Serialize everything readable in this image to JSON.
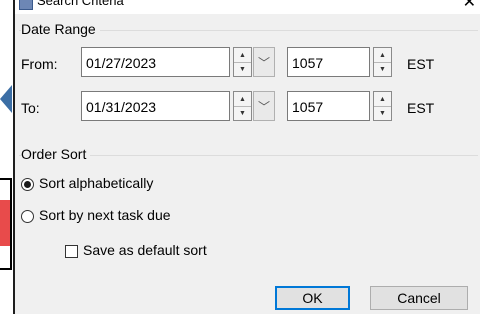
{
  "dialog": {
    "title": "Search Criteria",
    "close_glyph": "✕"
  },
  "date_range": {
    "group_label": "Date Range",
    "from": {
      "label": "From:",
      "date": "01/27/2023",
      "time": "1057",
      "tz": "EST"
    },
    "to": {
      "label": "To:",
      "date": "01/31/2023",
      "time": "1057",
      "tz": "EST"
    }
  },
  "order_sort": {
    "group_label": "Order Sort",
    "options": [
      {
        "label": "Sort alphabetically",
        "selected": true
      },
      {
        "label": "Sort by next task due",
        "selected": false
      }
    ],
    "save_default": {
      "label": "Save as default sort",
      "checked": false
    }
  },
  "buttons": {
    "ok": "OK",
    "cancel": "Cancel"
  },
  "icons": {
    "spin_up": "▲",
    "spin_down": "▼",
    "dropdown": "﹀"
  }
}
